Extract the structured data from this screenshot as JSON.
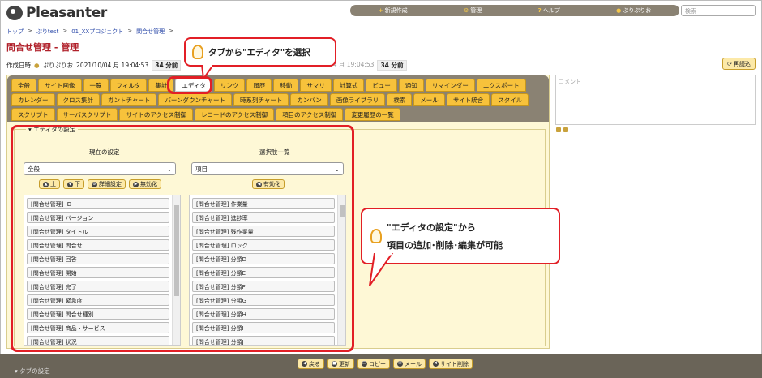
{
  "app": {
    "name": "Pleasanter"
  },
  "topnav": {
    "items": [
      "新規作成",
      "管理",
      "ヘルプ",
      "ぷりぷりお"
    ],
    "search_placeholder": "検索"
  },
  "breadcrumb": [
    "トップ",
    "ぷりtest",
    "01_XXプロジェクト",
    "問合せ管理"
  ],
  "page": {
    "title": "問合せ管理 - 管理"
  },
  "meta": {
    "created_label": "作成日時",
    "user": "ぷりぷりお",
    "datetime": "2021/10/04 月 19:04:53",
    "elapsed": "34 分前",
    "elapsed2": "34 分前",
    "updated_partial": "更新日時 ぷりぷりお 2021/10/04 月 19:04:53"
  },
  "reread_label": "再読込",
  "comment_placeholder": "コメント",
  "tabs_row1": [
    "全般",
    "サイト画像",
    "一覧",
    "フィルタ",
    "集計",
    "エディタ",
    "リンク",
    "履歴",
    "移動",
    "サマリ",
    "計算式",
    "ビュー",
    "通知",
    "リマインダー",
    "エクスポート"
  ],
  "tabs_row2": [
    "カレンダー",
    "クロス集計",
    "ガントチャート",
    "バーンダウンチャート",
    "時系列チャート",
    "カンバン",
    "画像ライブラリ",
    "検索",
    "メール",
    "サイト統合",
    "スタイル"
  ],
  "tabs_row3": [
    "スクリプト",
    "サーバスクリプト",
    "サイトのアクセス制御",
    "レコードのアクセス制御",
    "項目のアクセス制御",
    "変更履歴の一覧"
  ],
  "editor": {
    "legend": "エディタの設定",
    "current_heading": "現在の設定",
    "options_heading": "選択肢一覧",
    "current_select": "全般",
    "options_select": "項目",
    "buttons_left": [
      "上",
      "下",
      "詳細設定",
      "無効化"
    ],
    "buttons_right": [
      "有効化"
    ],
    "current_items": [
      "[問合せ管理] ID",
      "[問合せ管理] バージョン",
      "[問合せ管理] タイトル",
      "[問合せ管理] 問合せ",
      "[問合せ管理] 回答",
      "[問合せ管理] 開始",
      "[問合せ管理] 完了",
      "[問合せ管理] 緊急度",
      "[問合せ管理] 問合せ種別",
      "[問合せ管理] 商品・サービス",
      "[問合せ管理] 状況"
    ],
    "option_items": [
      "[問合せ管理] 作業量",
      "[問合せ管理] 進捗率",
      "[問合せ管理] 残作業量",
      "[問合せ管理] ロック",
      "[問合せ管理] 分類D",
      "[問合せ管理] 分類E",
      "[問合せ管理] 分類F",
      "[問合せ管理] 分類G",
      "[問合せ管理] 分類H",
      "[問合せ管理] 分類I",
      "[問合せ管理] 分類J"
    ]
  },
  "callouts": {
    "tab": "タブから\"エディタ\"を選択",
    "editor_line1": "\"エディタの設定\"から",
    "editor_line2": "項目の追加･削除･編集が可能"
  },
  "bottom_buttons": [
    "戻る",
    "更新",
    "コピー",
    "メール",
    "サイト削除"
  ],
  "tab_setting": "タブの設定",
  "colors": {
    "accent": "#f7c23b",
    "highlight": "#e21f26",
    "title": "#b0202a",
    "tabbar": "#8a8273"
  }
}
